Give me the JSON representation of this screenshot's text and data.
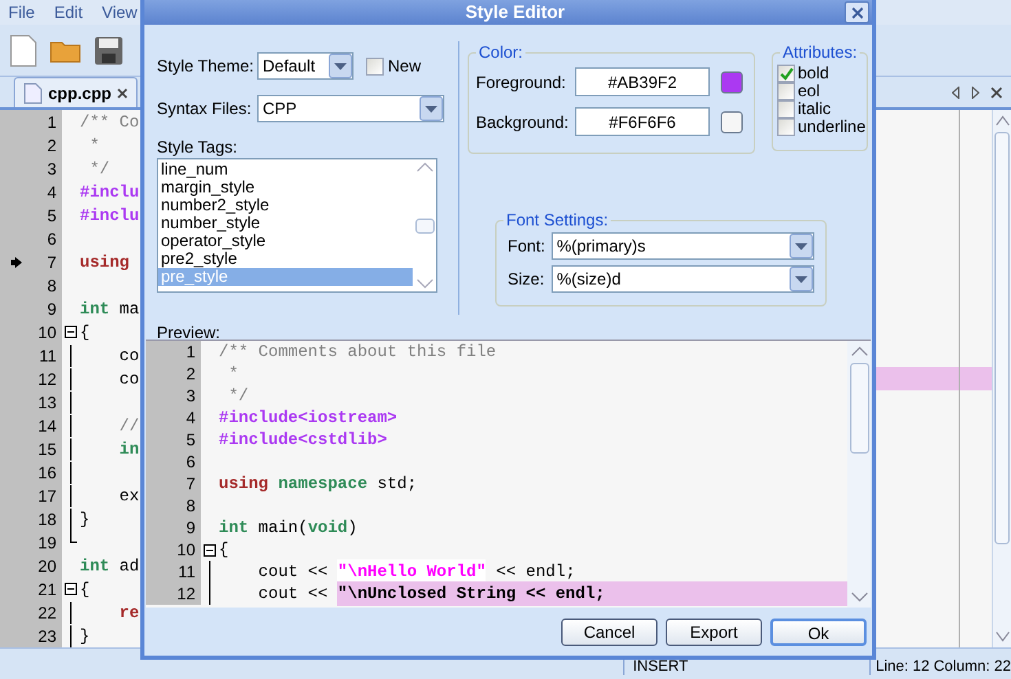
{
  "menu": [
    "File",
    "Edit",
    "View"
  ],
  "editor_tab": {
    "label": "cpp.cpp"
  },
  "editor": {
    "lines": [
      {
        "number": "1",
        "kind": "plain",
        "marker": false,
        "highlighted": false,
        "tokens": [
          {
            "text": "/** Co",
            "kind": "comment"
          }
        ]
      },
      {
        "number": "2",
        "kind": "plain",
        "marker": false,
        "highlighted": false,
        "tokens": [
          {
            "text": " *",
            "kind": "comment"
          }
        ]
      },
      {
        "number": "3",
        "kind": "plain",
        "marker": false,
        "highlighted": false,
        "tokens": [
          {
            "text": " */",
            "kind": "comment"
          }
        ]
      },
      {
        "number": "4",
        "kind": "plain",
        "marker": false,
        "highlighted": false,
        "tokens": [
          {
            "text": "#inclu",
            "kind": "preproc"
          }
        ]
      },
      {
        "number": "5",
        "kind": "plain",
        "marker": false,
        "highlighted": false,
        "tokens": [
          {
            "text": "#inclu",
            "kind": "preproc"
          }
        ]
      },
      {
        "number": "6",
        "kind": "plain",
        "marker": false,
        "highlighted": false
      },
      {
        "number": "7",
        "kind": "plain",
        "marker": true,
        "highlighted": false,
        "tokens": [
          {
            "text": "using",
            "kind": "keyword"
          }
        ]
      },
      {
        "number": "8",
        "kind": "plain",
        "marker": false,
        "highlighted": false
      },
      {
        "number": "9",
        "kind": "plain",
        "marker": false,
        "highlighted": false,
        "tokens": [
          {
            "text": "int",
            "kind": "type"
          },
          {
            "text": " ma",
            "kind": "plain"
          }
        ]
      },
      {
        "number": "10",
        "kind": "fold",
        "marker": false,
        "highlighted": false,
        "tokens": [
          {
            "text": "{",
            "kind": "plain"
          }
        ]
      },
      {
        "number": "11",
        "kind": "block",
        "marker": false,
        "highlighted": false,
        "tokens": [
          {
            "text": "    co",
            "kind": "plain"
          }
        ]
      },
      {
        "number": "12",
        "kind": "block",
        "marker": false,
        "highlighted": true,
        "tokens": [
          {
            "text": "    co",
            "kind": "plain"
          }
        ]
      },
      {
        "number": "13",
        "kind": "block",
        "marker": false,
        "highlighted": false
      },
      {
        "number": "14",
        "kind": "block",
        "marker": false,
        "highlighted": false,
        "tokens": [
          {
            "text": "    //",
            "kind": "comment"
          }
        ]
      },
      {
        "number": "15",
        "kind": "block",
        "marker": false,
        "highlighted": false,
        "tokens": [
          {
            "text": "    in",
            "kind": "type"
          }
        ]
      },
      {
        "number": "16",
        "kind": "block",
        "marker": false,
        "highlighted": false
      },
      {
        "number": "17",
        "kind": "block",
        "marker": false,
        "highlighted": false,
        "tokens": [
          {
            "text": "    ex",
            "kind": "plain"
          }
        ]
      },
      {
        "number": "18",
        "kind": "block",
        "marker": false,
        "highlighted": false,
        "tokens": [
          {
            "text": "}",
            "kind": "plain"
          }
        ]
      },
      {
        "number": "19",
        "kind": "end",
        "marker": false,
        "highlighted": false
      },
      {
        "number": "20",
        "kind": "plain",
        "marker": false,
        "highlighted": false,
        "tokens": [
          {
            "text": "int",
            "kind": "type"
          },
          {
            "text": " ad",
            "kind": "plain"
          }
        ]
      },
      {
        "number": "21",
        "kind": "fold",
        "marker": false,
        "highlighted": false,
        "tokens": [
          {
            "text": "{",
            "kind": "plain"
          }
        ]
      },
      {
        "number": "22",
        "kind": "block",
        "marker": false,
        "highlighted": false,
        "tokens": [
          {
            "text": "    re",
            "kind": "keyword"
          }
        ]
      },
      {
        "number": "23",
        "kind": "block",
        "marker": false,
        "highlighted": false,
        "tokens": [
          {
            "text": "}",
            "kind": "plain"
          }
        ]
      }
    ]
  },
  "status_bar": {
    "mode": "INSERT",
    "line": "Line: 12",
    "column": "Column: 22"
  },
  "dialog": {
    "title": "Style Editor",
    "style_theme": {
      "label": "Style Theme:",
      "value": "Default"
    },
    "new_checkbox": {
      "label": "New",
      "checked": false
    },
    "syntax_files": {
      "label": "Syntax Files:",
      "value": "CPP"
    },
    "style_tags": {
      "label": "Style Tags:",
      "items": [
        {
          "label": "line_num",
          "selected": false
        },
        {
          "label": "margin_style",
          "selected": false
        },
        {
          "label": "number2_style",
          "selected": false
        },
        {
          "label": "number_style",
          "selected": false
        },
        {
          "label": "operator_style",
          "selected": false
        },
        {
          "label": "pre2_style",
          "selected": false
        },
        {
          "label": "pre_style",
          "selected": true
        }
      ]
    },
    "color": {
      "title": "Color:",
      "foreground": {
        "label": "Foreground:",
        "value": "#AB39F2",
        "color": "#ab39f2"
      },
      "background": {
        "label": "Background:",
        "value": "#F6F6F6",
        "color": "#f6f6f6"
      }
    },
    "attributes": {
      "title": "Attributes:",
      "items": [
        {
          "label": "bold",
          "checked": true
        },
        {
          "label": "eol",
          "checked": false
        },
        {
          "label": "italic",
          "checked": false
        },
        {
          "label": "underline",
          "checked": false
        }
      ]
    },
    "font_settings": {
      "title": "Font Settings:",
      "font": {
        "label": "Font:",
        "value": "%(primary)s"
      },
      "size": {
        "label": "Size:",
        "value": "%(size)d"
      }
    },
    "preview": {
      "label": "Preview:",
      "lines": [
        {
          "number": "1",
          "kind": "plain",
          "tokens": [
            {
              "text": "/** Comments about this file",
              "kind": "comment"
            }
          ]
        },
        {
          "number": "2",
          "kind": "plain",
          "tokens": [
            {
              "text": " *",
              "kind": "comment"
            }
          ]
        },
        {
          "number": "3",
          "kind": "plain",
          "tokens": [
            {
              "text": " */",
              "kind": "comment"
            }
          ]
        },
        {
          "number": "4",
          "kind": "plain",
          "tokens": [
            {
              "text": "#include<iostream>",
              "kind": "preproc"
            }
          ]
        },
        {
          "number": "5",
          "kind": "plain",
          "tokens": [
            {
              "text": "#include<cstdlib>",
              "kind": "preproc"
            }
          ]
        },
        {
          "number": "6",
          "kind": "plain"
        },
        {
          "number": "7",
          "kind": "plain",
          "tokens": [
            {
              "text": "using ",
              "kind": "keyword"
            },
            {
              "text": "namespace",
              "kind": "type"
            },
            {
              "text": " std;",
              "kind": "plain"
            }
          ]
        },
        {
          "number": "8",
          "kind": "plain"
        },
        {
          "number": "9",
          "kind": "plain",
          "tokens": [
            {
              "text": "int",
              "kind": "type"
            },
            {
              "text": " main(",
              "kind": "plain"
            },
            {
              "text": "void",
              "kind": "type"
            },
            {
              "text": ")",
              "kind": "plain"
            }
          ]
        },
        {
          "number": "10",
          "kind": "fold",
          "tokens": [
            {
              "text": "{",
              "kind": "plain"
            }
          ]
        },
        {
          "number": "11",
          "kind": "block",
          "tokens": [
            {
              "text": "    cout << ",
              "kind": "plain"
            },
            {
              "text": "\"\\nHello World\"",
              "kind": "string"
            },
            {
              "text": " << endl;",
              "kind": "plain"
            }
          ]
        },
        {
          "number": "12",
          "kind": "block",
          "tokens": [
            {
              "text": "    cout << ",
              "kind": "plain"
            },
            {
              "text": "\"\\nUnclosed String << endl;",
              "kind": "unclosed"
            }
          ]
        }
      ]
    },
    "buttons": [
      {
        "label": "Cancel",
        "default": false
      },
      {
        "label": "Export",
        "default": false
      },
      {
        "label": "Ok",
        "default": true
      }
    ]
  }
}
